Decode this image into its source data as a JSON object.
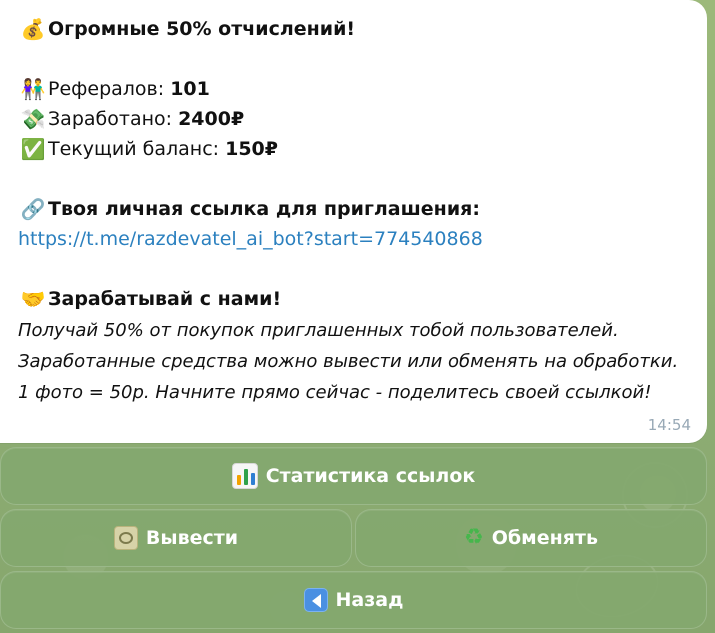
{
  "message": {
    "title": {
      "icon": "💰",
      "text": "Огромные 50% отчислений!"
    },
    "stats": [
      {
        "icon": "👫",
        "label": "Рефералов: ",
        "value": "101"
      },
      {
        "icon": "💸",
        "label": "Заработано: ",
        "value": "2400₽"
      },
      {
        "icon": "✅",
        "label": "Текущий баланс: ",
        "value": "150₽"
      }
    ],
    "invite": {
      "icon": "🔗",
      "title": "Твоя личная ссылка для приглашения:",
      "url": "https://t.me/razdevatel_ai_bot?start=774540868"
    },
    "earn": {
      "icon": "🤝",
      "title": "Зарабатывай с нами!",
      "body": "Получай 50% от покупок приглашенных тобой пользователей. Заработанные средства можно вывести или обменять на обработки. 1 фото = 50р. Начните прямо сейчас - поделитесь своей ссылкой!"
    },
    "time": "14:54"
  },
  "buttons": {
    "stats": {
      "label": "Статистика ссылок",
      "icon": "bar-chart-icon"
    },
    "withdraw": {
      "label": "Вывести",
      "icon": "money-icon"
    },
    "exchange": {
      "label": "Обменять",
      "icon": "recycle-icon"
    },
    "back": {
      "label": "Назад",
      "icon": "back-arrow-icon"
    }
  },
  "colors": {
    "link": "#2b80bf",
    "button_background": "#84a86f",
    "message_background": "#ffffff"
  }
}
